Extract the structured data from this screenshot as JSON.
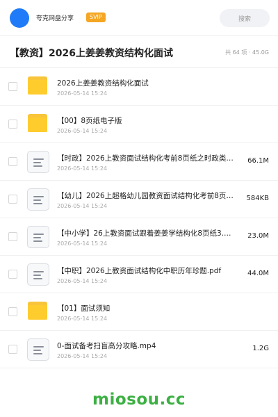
{
  "header": {
    "user_name": "夸克网盘分享",
    "badge": "SVIP",
    "search_placeholder": "搜索",
    "avatar_color": "#1f7bf7"
  },
  "folder": {
    "title": "【教资】2026上姜姜教资结构化面试",
    "meta": "共 64 项 · 45.0G"
  },
  "files": [
    {
      "type": "folder",
      "name": "2026上姜姜教资结构化面试",
      "date": "2026-05-14 15:24",
      "size": ""
    },
    {
      "type": "folder",
      "name": "【00】8页纸电子版",
      "date": "2026-05-14 15:24",
      "size": ""
    },
    {
      "type": "doc",
      "name": "【时政】2026上教资面试结构化考前8页纸之时政类…",
      "date": "2026-05-14 15:24",
      "size": "66.1M"
    },
    {
      "type": "doc",
      "name": "【幼儿】2026上超格幼儿园教资面试结构化考前8页…",
      "date": "2026-05-14 15:24",
      "size": "584KB"
    },
    {
      "type": "doc",
      "name": "【中小学】26上教资面试跟着姜姜学结构化8页纸3.…",
      "date": "2026-05-14 15:24",
      "size": "23.0M"
    },
    {
      "type": "doc",
      "name": "【中职】2026上教资面试结构化中职历年珍题.pdf",
      "date": "2026-05-14 15:24",
      "size": "44.0M"
    },
    {
      "type": "folder",
      "name": "【01】面试须知",
      "date": "2026-05-14 15:24",
      "size": ""
    },
    {
      "type": "doc",
      "name": "0-面试备考扫盲高分攻略.mp4",
      "date": "2026-05-14 15:24",
      "size": "1.2G"
    }
  ],
  "watermark": "miosou.cc"
}
